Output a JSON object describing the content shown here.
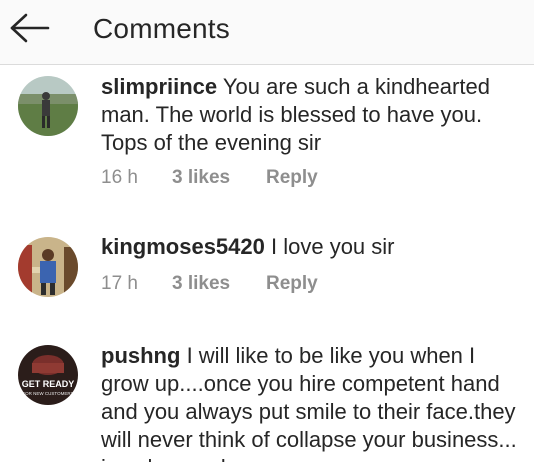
{
  "header": {
    "back_icon": "arrow-left-icon",
    "title": "Comments"
  },
  "comments": [
    {
      "username": "slimpriince",
      "text": "You are such a kindhearted man. The world is blessed to have you. Tops of the evening sir",
      "time": "16 h",
      "likes": "3 likes",
      "reply": "Reply",
      "avatar_colors": {
        "sky": "#b8c9c4",
        "grass": "#5f7d45",
        "figure": "#3a3a3a"
      }
    },
    {
      "username": "kingmoses5420",
      "text": "I love you sir",
      "time": "17 h",
      "likes": "3 likes",
      "reply": "Reply",
      "avatar_colors": {
        "bg": "#c9b48a",
        "shirt": "#3b64b0",
        "accent": "#a33b2e"
      }
    },
    {
      "username": "pushng",
      "text": "I will like to be like you when I grow up....once you hire competent hand and you always put smile to their face.they will never think of collapse your business... is only greedy",
      "time": "",
      "likes": "",
      "reply": "",
      "avatar_text_main": "GET READY",
      "avatar_text_sub": "FOR NEW CUSTOMERS",
      "avatar_colors": {
        "bg": "#2b1d1a",
        "cake": "#7a2f2b"
      }
    }
  ]
}
